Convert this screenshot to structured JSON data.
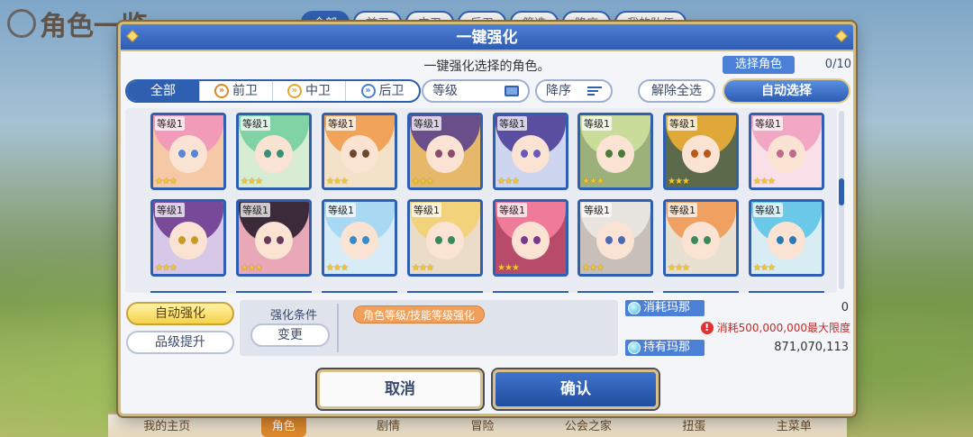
{
  "background": {
    "screen_title": "角色一览",
    "top_tabs": [
      "全部",
      "前卫",
      "中卫",
      "后卫",
      "筛选",
      "降序",
      "我的队伍"
    ],
    "bottom_nav": [
      "我的主页",
      "角色",
      "剧情",
      "冒险",
      "公会之家",
      "扭蛋",
      "主菜单"
    ]
  },
  "dialog": {
    "title": "一键强化",
    "subtitle": "一键强化选择的角色。",
    "selected_label": "选择角色",
    "selected_count": "0/10"
  },
  "filters": {
    "tabs": [
      {
        "label": "全部",
        "icon": "none",
        "active": true
      },
      {
        "label": "前卫",
        "icon": "vanguard-icon",
        "active": false
      },
      {
        "label": "中卫",
        "icon": "midguard-icon",
        "active": false
      },
      {
        "label": "后卫",
        "icon": "rearguard-icon",
        "active": false
      }
    ],
    "sort_label": "等级",
    "order_label": "降序",
    "clear_all": "解除全选",
    "auto_select": "自动选择"
  },
  "characters": [
    {
      "level": "等级1",
      "stars": 3,
      "hair": "#f29bb8",
      "bg": "#f6c9a6",
      "eyes": "#5a86d8"
    },
    {
      "level": "等级1",
      "stars": 3,
      "hair": "#7fd3a4",
      "bg": "#d8ecd4",
      "eyes": "#3c8e7a"
    },
    {
      "level": "等级1",
      "stars": 3,
      "hair": "#f2a35a",
      "bg": "#f3e2c8",
      "eyes": "#6a4a2a"
    },
    {
      "level": "等级1",
      "stars": 3,
      "hair": "#6a4e8a",
      "bg": "#e6b86a",
      "eyes": "#8a4a6a"
    },
    {
      "level": "等级1",
      "stars": 3,
      "hair": "#5a4ea0",
      "bg": "#cdd6ee",
      "eyes": "#6a58b8"
    },
    {
      "level": "等级1",
      "stars": 3,
      "hair": "#c9dc9a",
      "bg": "#9cb07a",
      "eyes": "#4a7a3a"
    },
    {
      "level": "等级1",
      "stars": 3,
      "hair": "#e0a838",
      "bg": "#5a6a4a",
      "eyes": "#b85a1a"
    },
    {
      "level": "等级1",
      "stars": 3,
      "hair": "#f2a8c4",
      "bg": "#f8dfe8",
      "eyes": "#c06a8a"
    },
    {
      "level": "等级1",
      "stars": 3,
      "hair": "#7a4a9a",
      "bg": "#d8c8e8",
      "eyes": "#c89a2a"
    },
    {
      "level": "等级1",
      "stars": 3,
      "hair": "#3a2a3a",
      "bg": "#e8a8b8",
      "eyes": "#6a3a5a"
    },
    {
      "level": "等级1",
      "stars": 3,
      "hair": "#a8d8f2",
      "bg": "#d8ecf8",
      "eyes": "#3a8ac8"
    },
    {
      "level": "等级1",
      "stars": 3,
      "hair": "#f2d27a",
      "bg": "#eadcc8",
      "eyes": "#3a8a5a"
    },
    {
      "level": "等级1",
      "stars": 3,
      "hair": "#f07a9a",
      "bg": "#b84a6a",
      "eyes": "#7a3a8a"
    },
    {
      "level": "等级1",
      "stars": 3,
      "hair": "#e8e4e0",
      "bg": "#c8c0b8",
      "eyes": "#4a6ab8"
    },
    {
      "level": "等级1",
      "stars": 3,
      "hair": "#f0a060",
      "bg": "#e8e0d0",
      "eyes": "#3a8a5a"
    },
    {
      "level": "等级1",
      "stars": 3,
      "hair": "#6ac8e8",
      "bg": "#d8ecf4",
      "eyes": "#2a7ab8"
    }
  ],
  "options": {
    "auto_enhance": "自动强化",
    "rank_up": "品级提升",
    "condition_label": "强化条件",
    "change": "变更",
    "condition_tag": "角色等级/技能等级强化"
  },
  "mana": {
    "cost_label": "消耗玛那",
    "cost_value": "0",
    "warning": "消耗500,000,000最大限度",
    "owned_label": "持有玛那",
    "owned_value": "871,070,113"
  },
  "actions": {
    "cancel": "取消",
    "confirm": "确认"
  },
  "colors": {
    "accent_blue": "#2f5fb0",
    "gold_frame": "#d3b97a",
    "warning_red": "#c22a2a",
    "tag_orange": "#f0a05a"
  }
}
